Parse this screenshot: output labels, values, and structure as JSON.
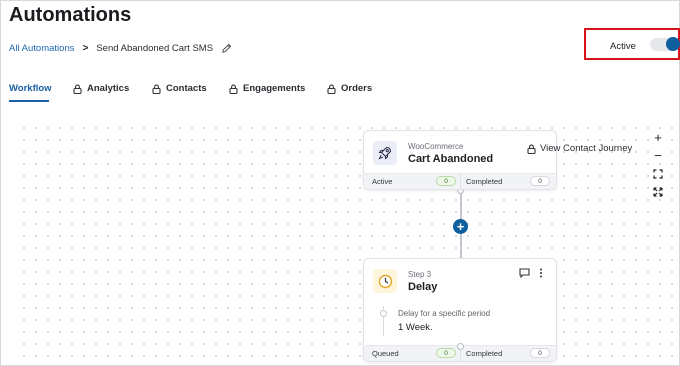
{
  "page": {
    "title": "Automations"
  },
  "breadcrumb": {
    "link": "All Automations",
    "separator": ">",
    "current": "Send Abandoned Cart SMS",
    "edit_icon": "pencil-icon"
  },
  "status": {
    "label": "Active",
    "toggle_on": true,
    "toggle_color": "#0e5fa0",
    "highlight_color": "#d8141b"
  },
  "tabs": [
    {
      "label": "Workflow",
      "active": true,
      "icon": ""
    },
    {
      "label": "Analytics",
      "active": false,
      "icon": "lock-icon"
    },
    {
      "label": "Contacts",
      "active": false,
      "icon": "lock-icon"
    },
    {
      "label": "Engagements",
      "active": false,
      "icon": "lock-icon"
    },
    {
      "label": "Orders",
      "active": false,
      "icon": "lock-icon"
    }
  ],
  "zoom_controls": {
    "zoom_in": "+",
    "zoom_out": "−"
  },
  "trigger_node": {
    "source": "WooCommerce",
    "title": "Cart Abandoned",
    "icon": "rocket-icon",
    "view_journey": "View Contact Journey",
    "footer": {
      "left_label": "Active",
      "left_count": "0",
      "right_label": "Completed",
      "right_count": "0"
    }
  },
  "add_step": {
    "label": "+"
  },
  "delay_node": {
    "step": "Step 3",
    "title": "Delay",
    "icon": "clock-icon",
    "description": "Delay for a specific period",
    "value": "1 Week.",
    "footer": {
      "left_label": "Queued",
      "left_count": "0",
      "right_label": "Completed",
      "right_count": "0"
    }
  }
}
